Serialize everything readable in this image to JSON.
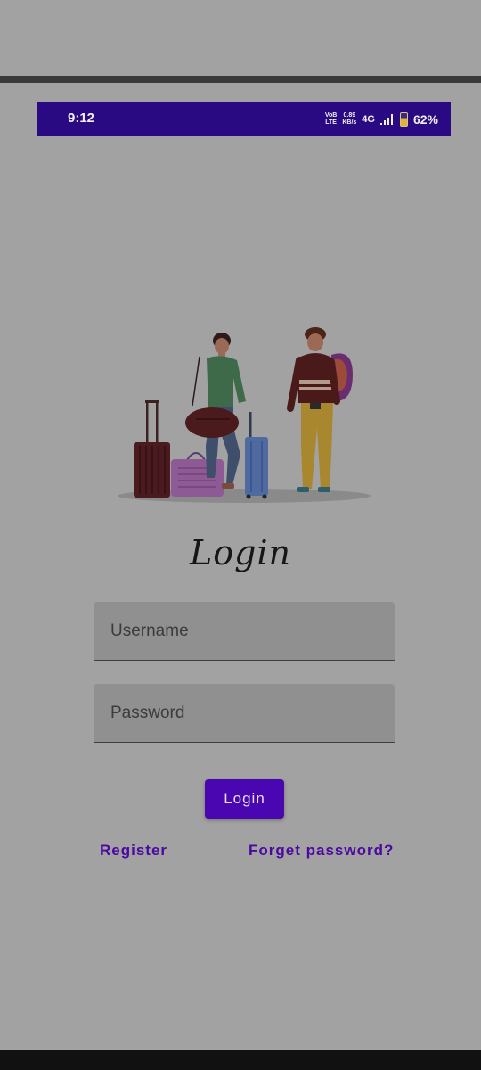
{
  "status_bar": {
    "time": "9:12",
    "volte_line1": "VoB",
    "volte_line2": "LTE",
    "speed_line1": "0.89",
    "speed_line2": "KB/s",
    "network": "4G",
    "battery": "62%",
    "background_color": "#2a0a82"
  },
  "login": {
    "title": "Login",
    "username_placeholder": "Username",
    "password_placeholder": "Password",
    "button_label": "Login",
    "register_label": "Register",
    "forget_label": "Forget password?",
    "accent_color": "#4a06b0"
  },
  "illustration": {
    "description_icon": "travelers-luggage-illustration"
  }
}
